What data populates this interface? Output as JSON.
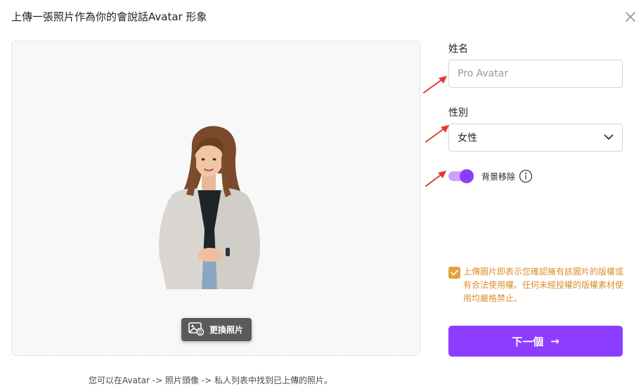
{
  "dialog": {
    "title": "上傳一張照片作為你的會說話Avatar 形象",
    "close_icon": "close-icon"
  },
  "upload": {
    "replace_label": "更換照片",
    "replace_icon": "image-swap-icon",
    "hint": "您可以在Avatar -> 照片頭像 -> 私人列表中找到已上傳的照片。"
  },
  "form": {
    "name_label": "姓名",
    "name_placeholder": "Pro Avatar",
    "name_value": "",
    "gender_label": "性別",
    "gender_value": "女性",
    "bg_remove_label": "背景移除",
    "bg_remove_on": true,
    "info_icon": "info-icon"
  },
  "consent": {
    "checked": true,
    "text": "上傳圖片即表示您確認擁有該圖片的版權或有合法使用權。任何未經授權的版權素材使用均嚴格禁止。"
  },
  "actions": {
    "next_label": "下一個",
    "next_arrow": "→"
  },
  "colors": {
    "accent": "#8d3dff",
    "toggle_track": "#c9a4ff",
    "consent": "#d9902c",
    "annotation_arrow": "#e53935"
  }
}
